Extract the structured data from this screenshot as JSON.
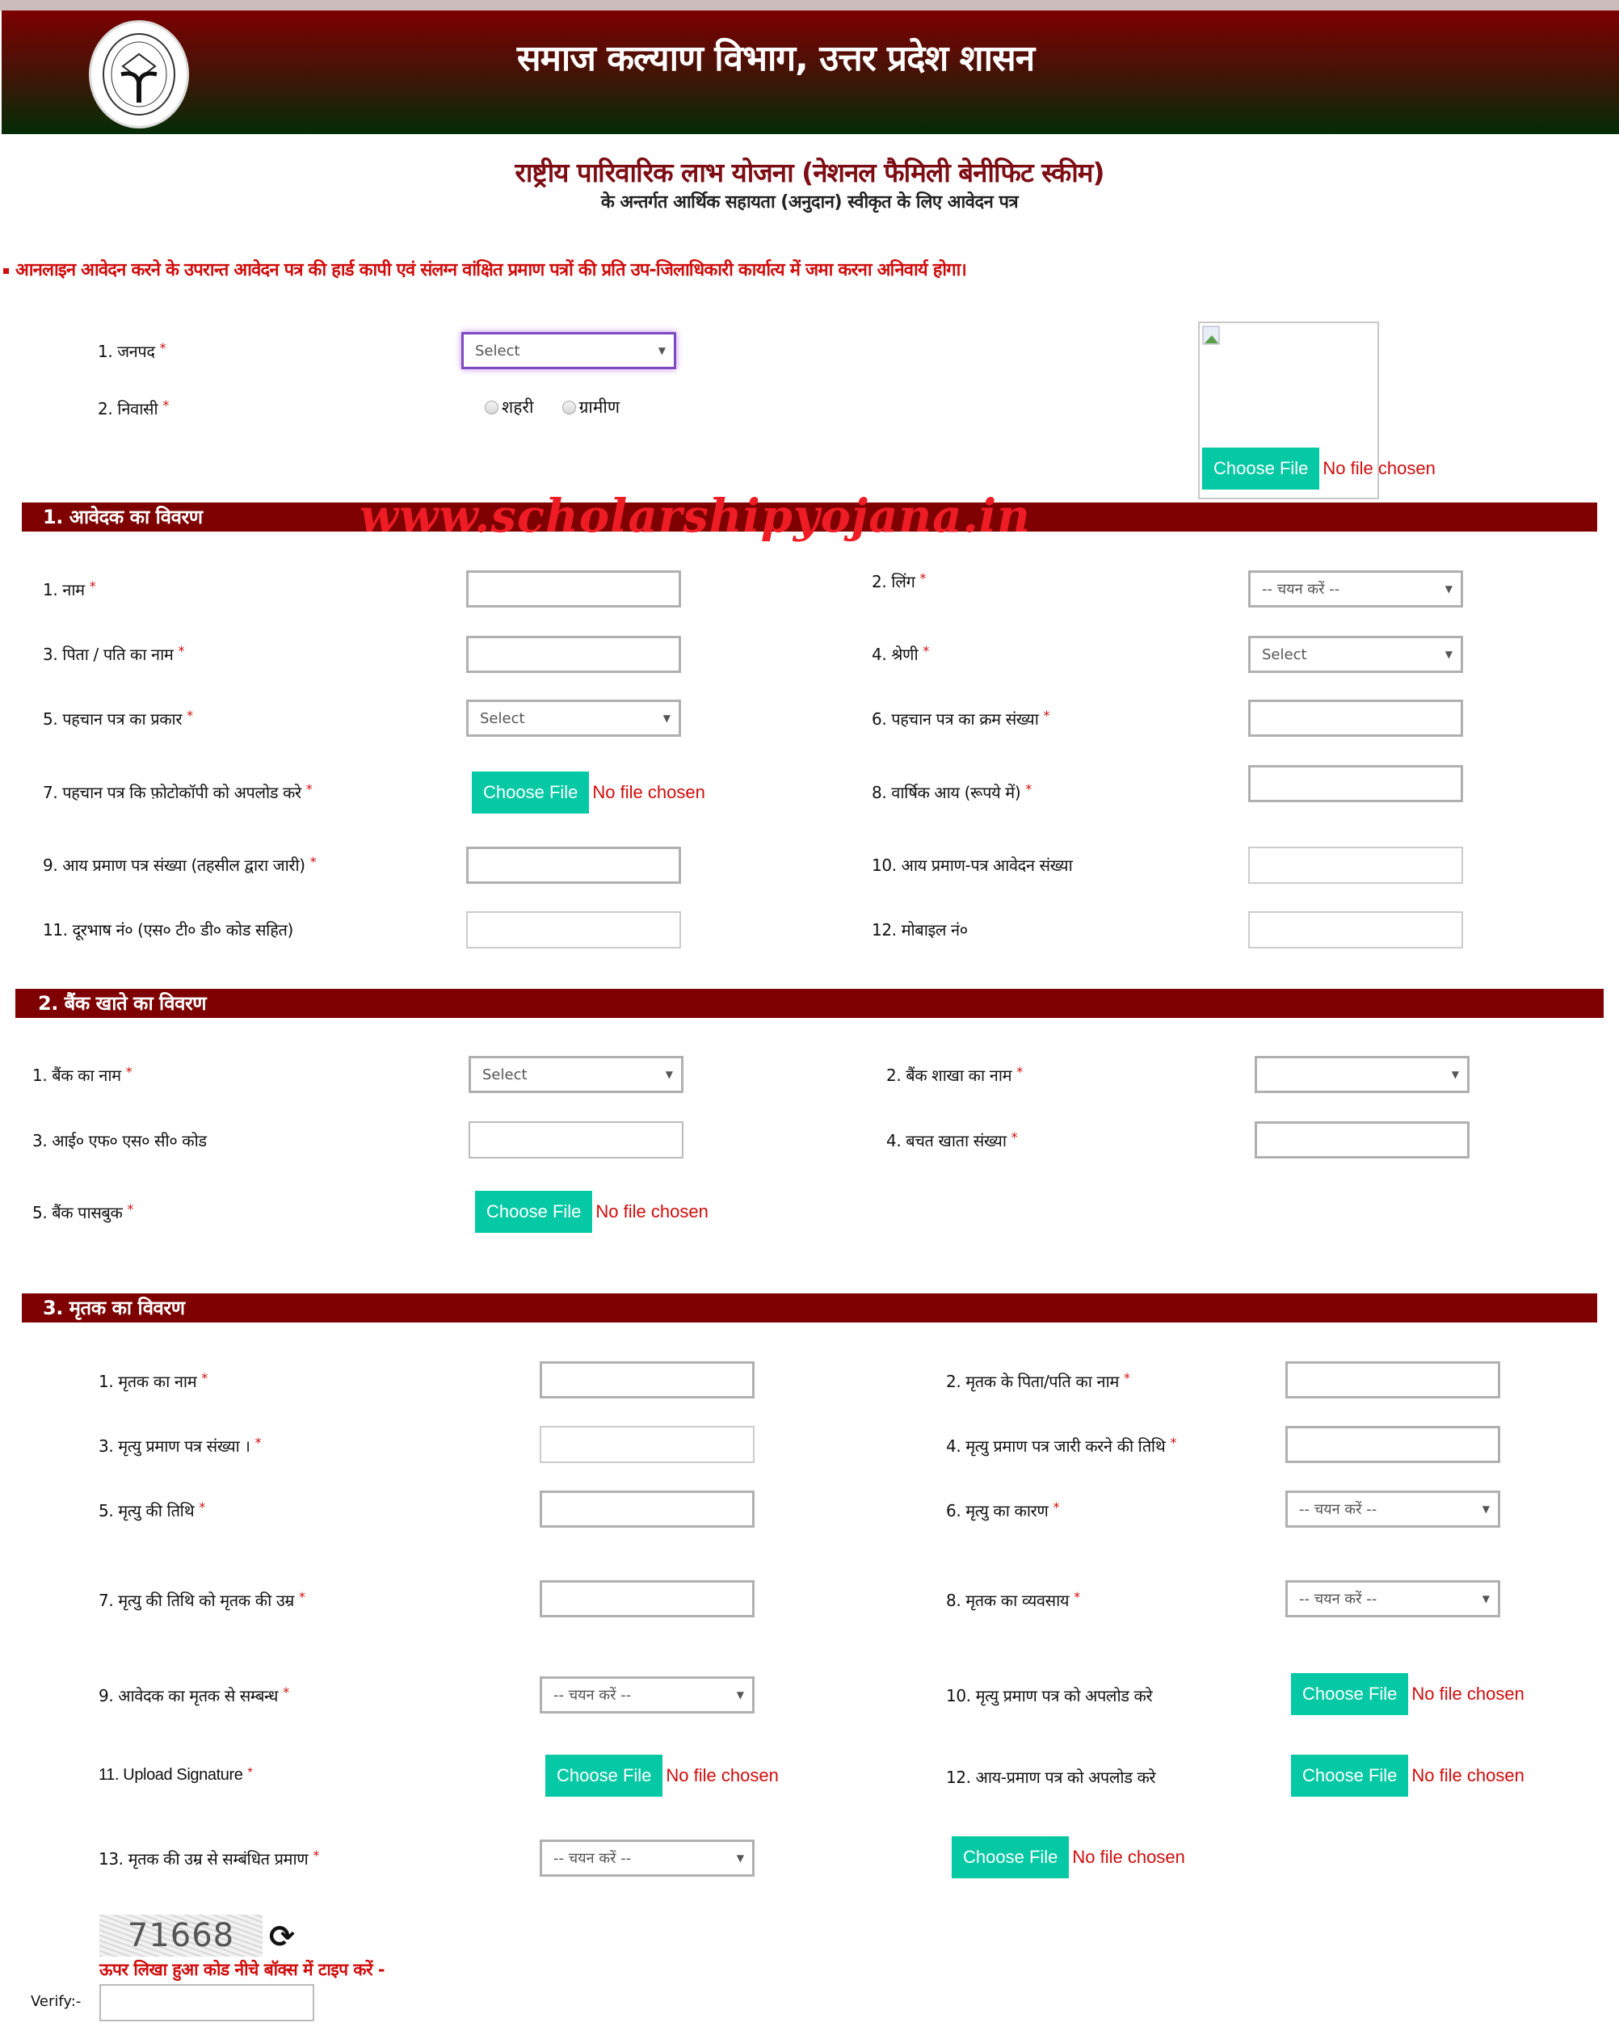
{
  "header": {
    "department_title": "समाज कल्याण विभाग, उत्तर प्रदेश शासन",
    "emblem": "up-government-emblem"
  },
  "scheme": {
    "title": "राष्ट्रीय पारिवारिक लाभ योजना (नेशनल फैमिली बेनीफिट स्कीम)",
    "subtitle": "के अन्तर्गत आर्थिक सहायता (अनुदान) स्वीकृत के लिए आवेदन पत्र"
  },
  "notice": "आनलाइन आवेदन करने के उपरान्त आवेदन पत्र की हार्ड कापी एवं संलग्न वांक्षित प्रमाण पत्रों की प्रति उप-जिलाधिकारी कार्यात्य में जमा करना अनिवार्य होगा।",
  "required_mark": "*",
  "file_input": {
    "button": "Choose File",
    "status": "No file chosen"
  },
  "top": {
    "district": {
      "label": "1. जनपद",
      "value": "Select"
    },
    "residence": {
      "label": "2. निवासी",
      "options": [
        "शहरी",
        "ग्रामीण"
      ]
    },
    "photo": {
      "alt": "broken-image-icon"
    }
  },
  "watermark": "www.scholarshipyojana.in",
  "section1": {
    "title": "1. आवेदक का विवरण",
    "fields": {
      "name": "1. नाम",
      "gender": "2. लिंग",
      "gender_value": "-- चयन करें --",
      "father_name": "3. पिता / पति का नाम",
      "category": "4. श्रेणी",
      "category_value": "Select",
      "id_type": "5. पहचान पत्र का प्रकार",
      "id_type_value": "Select",
      "id_number": "6. पहचान पत्र का क्रम संख्या",
      "id_upload": "7. पहचान पत्र कि फ़ोटोकॉपी को अपलोड करे",
      "annual_income": "8. वार्षिक आय (रूपये में)",
      "income_cert_no": "9. आय प्रमाण पत्र संख्या (तहसील द्वारा जारी)",
      "income_cert_app_no": "10. आय प्रमाण-पत्र आवेदन संख्या",
      "phone": "11. दूरभाष नं० (एस० टी० डी० कोड सहित)",
      "mobile": "12. मोबाइल नं०"
    }
  },
  "section2": {
    "title": "2. बैंक खाते का विवरण",
    "fields": {
      "bank_name": "1. बैंक का नाम",
      "bank_name_value": "Select",
      "branch_name": "2. बैंक शाखा का नाम",
      "branch_name_value": "",
      "ifsc": "3. आई० एफ० एस० सी० कोड",
      "account_no": "4. बचत खाता संख्या",
      "passbook": "5. बैंक पासबुक"
    }
  },
  "section3": {
    "title": "3. मृतक का विवरण",
    "fields": {
      "deceased_name": "1. मृतक का नाम",
      "deceased_father": "2. मृतक के पिता/पति का नाम",
      "death_cert_no": "3. मृत्यु प्रमाण पत्र संख्या ।",
      "death_cert_date": "4. मृत्यु प्रमाण पत्र जारी करने की तिथि",
      "death_date": "5. मृत्यु की तिथि",
      "death_cause": "6. मृत्यु का कारण",
      "death_cause_value": "-- चयन करें --",
      "age_at_death": "7. मृत्यु की तिथि को मृतक की उम्र",
      "occupation": "8. मृतक का व्यवसाय",
      "occupation_value": "-- चयन करें --",
      "relation": "9. आवेदक का मृतक से सम्बन्ध",
      "relation_value": "-- चयन करें --",
      "death_cert_upload": "10. मृत्यु प्रमाण पत्र को अपलोड करे",
      "signature": "11. Upload Signature",
      "income_cert_upload": "12. आय-प्रमाण पत्र को अपलोड करे",
      "age_proof": "13. मृतक की उम्र से सम्बंधित प्रमाण",
      "age_proof_value": "-- चयन करें --"
    }
  },
  "captcha": {
    "code": "71668",
    "hint": "ऊपर लिखा हुआ कोड नीचे बॉक्स में टाइप करें -",
    "verify_label": "Verify:-",
    "verify_value": ""
  },
  "colors": {
    "section_bar": "#7e0000",
    "file_button": "#05c9a4",
    "error_red": "#d10c0c",
    "title_maroon": "#7d0c13"
  }
}
